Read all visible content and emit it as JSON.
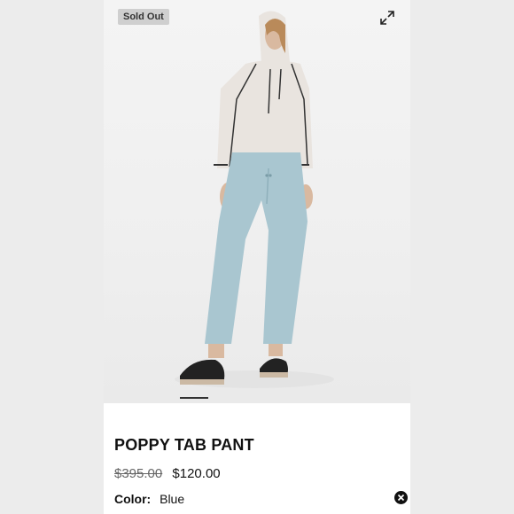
{
  "product": {
    "badge": "Sold Out",
    "title": "POPPY TAB PANT",
    "original_price": "$395.00",
    "sale_price": "$120.00",
    "color_label": "Color:",
    "color_value": "Blue"
  },
  "gallery": {
    "image_alt": "Model wearing light hoodie and light blue tab pants with black sandals"
  },
  "icons": {
    "expand": "expand-icon",
    "close": "close-circle-icon"
  },
  "colors": {
    "pants": "#a9c6d0",
    "hoodie": "#e9e4df",
    "panel_background": "#ffffff",
    "side_background": "#ececec"
  }
}
